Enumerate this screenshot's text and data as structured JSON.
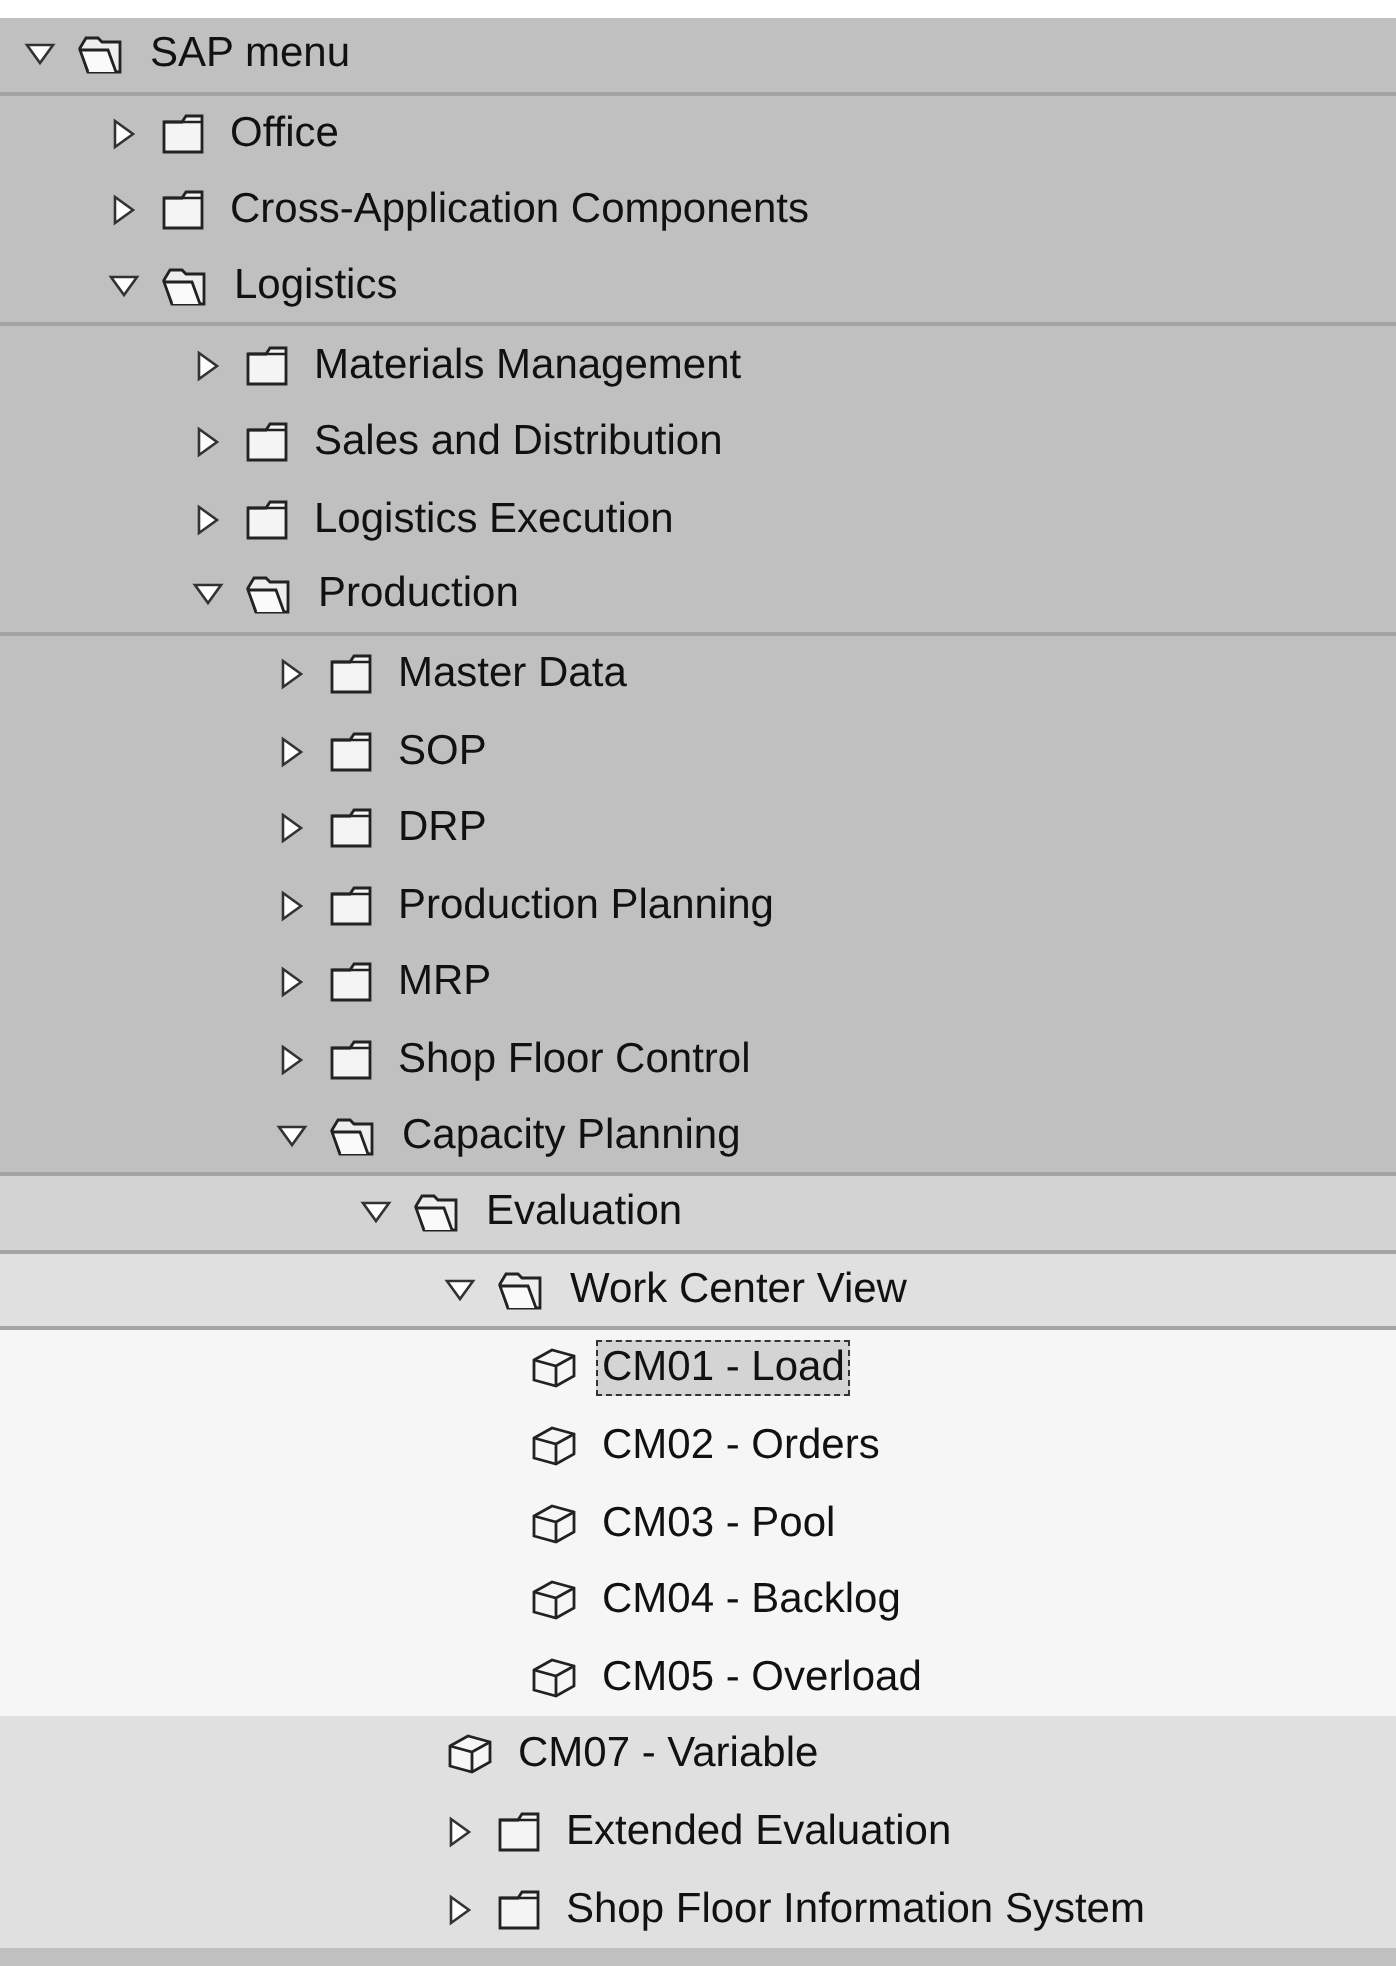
{
  "tree": [
    {
      "label": "SAP menu",
      "kind": "folder",
      "expanded": true,
      "selected": false,
      "children": [
        {
          "label": "Office",
          "kind": "folder",
          "expanded": false,
          "selected": false
        },
        {
          "label": "Cross-Application Components",
          "kind": "folder",
          "expanded": false,
          "selected": false
        },
        {
          "label": "Logistics",
          "kind": "folder",
          "expanded": true,
          "selected": false,
          "children": [
            {
              "label": "Materials Management",
              "kind": "folder",
              "expanded": false,
              "selected": false
            },
            {
              "label": "Sales and Distribution",
              "kind": "folder",
              "expanded": false,
              "selected": false
            },
            {
              "label": "Logistics Execution",
              "kind": "folder",
              "expanded": false,
              "selected": false
            },
            {
              "label": "Production",
              "kind": "folder",
              "expanded": true,
              "selected": false,
              "children": [
                {
                  "label": "Master Data",
                  "kind": "folder",
                  "expanded": false,
                  "selected": false
                },
                {
                  "label": "SOP",
                  "kind": "folder",
                  "expanded": false,
                  "selected": false
                },
                {
                  "label": "DRP",
                  "kind": "folder",
                  "expanded": false,
                  "selected": false
                },
                {
                  "label": "Production Planning",
                  "kind": "folder",
                  "expanded": false,
                  "selected": false
                },
                {
                  "label": "MRP",
                  "kind": "folder",
                  "expanded": false,
                  "selected": false
                },
                {
                  "label": "Shop Floor Control",
                  "kind": "folder",
                  "expanded": false,
                  "selected": false
                },
                {
                  "label": "Capacity Planning",
                  "kind": "folder",
                  "expanded": true,
                  "selected": false,
                  "children": [
                    {
                      "label": "Evaluation",
                      "kind": "folder",
                      "expanded": true,
                      "selected": false,
                      "children": [
                        {
                          "label": "Work Center View",
                          "kind": "folder",
                          "expanded": true,
                          "selected": false,
                          "children": [
                            {
                              "label": "CM01 - Load",
                              "kind": "transaction",
                              "selected": true
                            },
                            {
                              "label": "CM02 - Orders",
                              "kind": "transaction",
                              "selected": false
                            },
                            {
                              "label": "CM03 - Pool",
                              "kind": "transaction",
                              "selected": false
                            },
                            {
                              "label": "CM04 - Backlog",
                              "kind": "transaction",
                              "selected": false
                            },
                            {
                              "label": "CM05 - Overload",
                              "kind": "transaction",
                              "selected": false
                            }
                          ]
                        },
                        {
                          "label": "CM07 - Variable",
                          "kind": "transaction",
                          "selected": false
                        },
                        {
                          "label": "Extended Evaluation",
                          "kind": "folder",
                          "expanded": false,
                          "selected": false
                        },
                        {
                          "label": "Shop Floor Information System",
                          "kind": "folder",
                          "expanded": false,
                          "selected": false
                        }
                      ]
                    }
                  ]
                }
              ]
            }
          ]
        }
      ]
    }
  ]
}
